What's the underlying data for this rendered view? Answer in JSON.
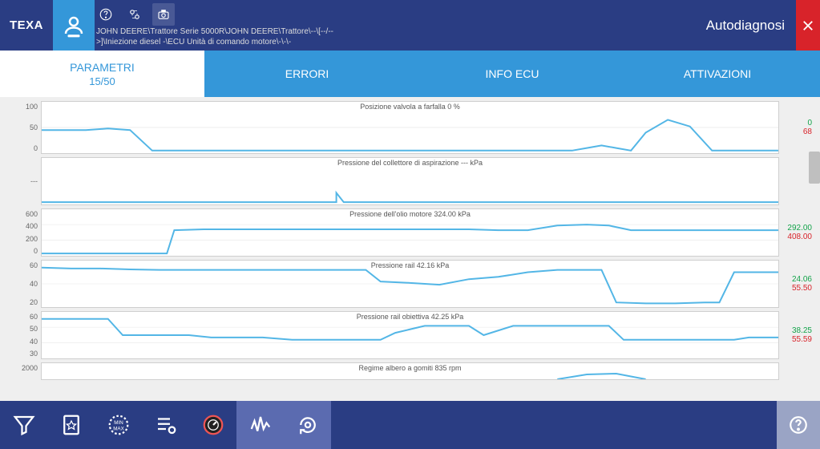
{
  "brand": "TEXA",
  "mode_label": "Autodiagnosi",
  "breadcrumb": "JOHN DEERE\\Trattore Serie 5000R\\JOHN DEERE\\Trattore\\--\\[--/-->]\\Iniezione diesel -\\ECU Unità di comando motore\\-\\-\\-",
  "tabs": {
    "parametri": {
      "label": "PARAMETRI",
      "sub": "15/50"
    },
    "errori": {
      "label": "ERRORI"
    },
    "infoecu": {
      "label": "INFO ECU"
    },
    "attivazioni": {
      "label": "ATTIVAZIONI"
    }
  },
  "params": [
    {
      "title": "Posizione valvola a farfalla   0   %",
      "yticks": [
        "100",
        "50",
        "0"
      ],
      "lo": "0",
      "hi": "68",
      "h": 58
    },
    {
      "title": "Pressione del collettore di aspirazione   ---   kPa",
      "yticks": [
        "---"
      ],
      "lo": "",
      "hi": "",
      "h": 58
    },
    {
      "title": "Pressione dell'olio motore   324.00   kPa",
      "yticks": [
        "600",
        "400",
        "200",
        "0"
      ],
      "lo": "292.00",
      "hi": "408.00",
      "h": 58
    },
    {
      "title": "Pressione rail   42.16   kPa",
      "yticks": [
        "60",
        "40",
        "20"
      ],
      "lo": "24.06",
      "hi": "55.50",
      "h": 58
    },
    {
      "title": "Pressione rail obiettiva   42.25   kPa",
      "yticks": [
        "60",
        "50",
        "40",
        "30"
      ],
      "lo": "38.25",
      "hi": "55.59",
      "h": 58
    },
    {
      "title": "Regime albero a gomiti   835   rpm",
      "yticks": [
        "2000"
      ],
      "lo": "",
      "hi": "",
      "h": 20
    }
  ],
  "chart_data": [
    {
      "type": "line",
      "title": "Posizione valvola a farfalla 0 %",
      "ylabel": "%",
      "ylim": [
        0,
        100
      ],
      "series": [
        {
          "name": "throttle",
          "values": [
            45,
            45,
            45,
            48,
            45,
            5,
            5,
            5,
            5,
            5,
            5,
            5,
            5,
            5,
            5,
            5,
            5,
            5,
            5,
            5,
            5,
            5,
            5,
            5,
            5,
            5,
            12,
            15,
            10,
            5,
            38,
            62,
            50,
            5,
            5,
            5
          ]
        }
      ],
      "min": 0,
      "max": 68
    },
    {
      "type": "line",
      "title": "Pressione del collettore di aspirazione --- kPa",
      "ylabel": "kPa",
      "ylim": null,
      "series": [
        {
          "name": "map",
          "values": [
            0,
            0,
            0,
            0,
            0,
            0,
            0,
            0,
            0,
            0,
            0,
            0,
            0,
            0,
            0,
            0,
            0,
            0,
            0.2,
            0,
            0,
            0,
            0,
            0,
            0,
            0,
            0,
            0,
            0,
            0,
            0,
            0,
            0,
            0,
            0,
            0
          ]
        }
      ],
      "min": null,
      "max": null
    },
    {
      "type": "line",
      "title": "Pressione dell'olio motore 324.00 kPa",
      "ylabel": "kPa",
      "ylim": [
        0,
        600
      ],
      "series": [
        {
          "name": "oil",
          "values": [
            30,
            30,
            30,
            30,
            30,
            30,
            320,
            340,
            340,
            340,
            340,
            340,
            340,
            340,
            340,
            340,
            340,
            340,
            340,
            340,
            340,
            340,
            330,
            330,
            330,
            380,
            400,
            390,
            330,
            330,
            330,
            330,
            330,
            330,
            330,
            330
          ]
        }
      ],
      "min": 292.0,
      "max": 408.0
    },
    {
      "type": "line",
      "title": "Pressione rail 42.16 kPa",
      "ylabel": "kPa",
      "ylim": [
        20,
        60
      ],
      "series": [
        {
          "name": "rail",
          "values": [
            55,
            54,
            54,
            53,
            53,
            52,
            52,
            52,
            52,
            52,
            52,
            52,
            52,
            52,
            52,
            52,
            52,
            42,
            43,
            41,
            42,
            40,
            45,
            44,
            48,
            50,
            53,
            53,
            53,
            27,
            26,
            27,
            26,
            27,
            28,
            50
          ]
        }
      ],
      "min": 24.06,
      "max": 55.5
    },
    {
      "type": "line",
      "title": "Pressione rail obiettiva 42.25 kPa",
      "ylabel": "kPa",
      "ylim": [
        30,
        60
      ],
      "series": [
        {
          "name": "rail_target",
          "values": [
            55,
            55,
            55,
            45,
            45,
            45,
            45,
            45,
            44,
            44,
            44,
            43,
            43,
            43,
            43,
            43,
            43,
            43,
            45,
            50,
            50,
            50,
            50,
            45,
            50,
            50,
            50,
            50,
            50,
            43,
            43,
            43,
            43,
            43,
            43,
            43
          ]
        }
      ],
      "min": 38.25,
      "max": 55.59
    },
    {
      "type": "line",
      "title": "Regime albero a gomiti 835 rpm",
      "ylabel": "rpm",
      "ylim": [
        0,
        2000
      ],
      "series": [
        {
          "name": "rpm",
          "values": []
        }
      ],
      "min": null,
      "max": null
    }
  ]
}
